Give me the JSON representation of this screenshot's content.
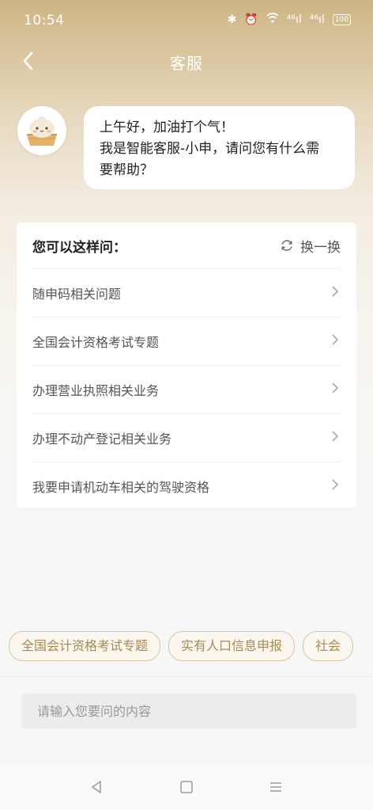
{
  "status_bar": {
    "time": "10:54",
    "signal_1": "⁴⁶ıl",
    "signal_2": "⁴⁶ıl",
    "battery": "100"
  },
  "nav": {
    "title": "客服",
    "back_icon": "chevron-left-icon"
  },
  "greeting": {
    "line1": "上午好，加油打个气！",
    "line2": "我是智能客服-小申，请问您有什么需",
    "line3": "要帮助？"
  },
  "suggestions": {
    "title": "您可以这样问：",
    "refresh_label": "换一换",
    "items": [
      {
        "label": "随申码相关问题"
      },
      {
        "label": "全国会计资格考试专题"
      },
      {
        "label": "办理营业执照相关业务"
      },
      {
        "label": "办理不动产登记相关业务"
      },
      {
        "label": "我要申请机动车相关的驾驶资格"
      }
    ]
  },
  "quick_chips": [
    {
      "label": "全国会计资格考试专题"
    },
    {
      "label": "实有人口信息申报"
    },
    {
      "label": "社会"
    }
  ],
  "input": {
    "placeholder": "请输入您要问的内容",
    "value": ""
  },
  "colors": {
    "header_gold": "#cdb584",
    "chip_text": "#a58a55",
    "chip_border": "#d7c6a3"
  }
}
